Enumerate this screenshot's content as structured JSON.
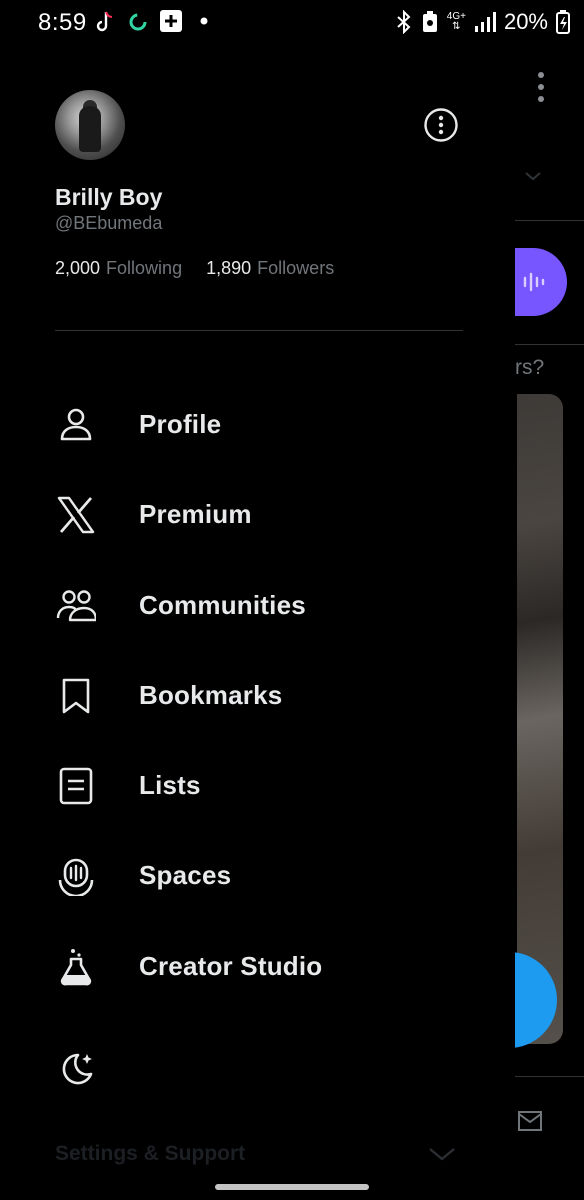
{
  "status_bar": {
    "time": "8:59",
    "network": "4G+",
    "battery": "20%"
  },
  "profile": {
    "display_name": "Brilly Boy",
    "handle": "@BEbumeda",
    "following_count": "2,000",
    "following_label": "Following",
    "followers_count": "1,890",
    "followers_label": "Followers"
  },
  "menu": [
    {
      "label": "Profile",
      "icon": "person-icon"
    },
    {
      "label": "Premium",
      "icon": "x-logo-icon"
    },
    {
      "label": "Communities",
      "icon": "communities-icon"
    },
    {
      "label": "Bookmarks",
      "icon": "bookmark-icon"
    },
    {
      "label": "Lists",
      "icon": "list-icon"
    },
    {
      "label": "Spaces",
      "icon": "spaces-icon"
    },
    {
      "label": "Creator Studio",
      "icon": "flask-icon"
    }
  ],
  "footer": {
    "settings_label": "Settings & Support"
  },
  "background": {
    "partial_text": "rs?"
  },
  "colors": {
    "background": "#000000",
    "text_primary": "#e7e9ea",
    "text_secondary": "#71767b",
    "divider": "#2f3336",
    "spaces_accent": "#7856ff",
    "fab_accent": "#1d9bf0"
  }
}
